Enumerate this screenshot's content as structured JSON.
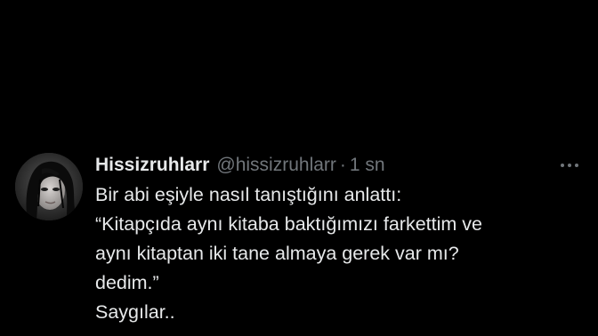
{
  "tweet": {
    "author": {
      "display_name": "Hissizruhlarr",
      "handle": "@hissizruhlarr",
      "avatar": "avatar-image"
    },
    "separator": "·",
    "timestamp": "1 sn",
    "more_icon": "more-horizontal-icon",
    "lines": [
      "Bir abi eşiyle nasıl tanıştığını anlattı:",
      "“Kitapçıda aynı kitaba baktığımızı farkettim ve",
      "aynı kitaptan iki tane almaya gerek var mı?",
      "dedim.”",
      "Saygılar.."
    ]
  },
  "colors": {
    "background": "#000000",
    "text_primary": "#e7e9ea",
    "text_secondary": "#71767b"
  }
}
